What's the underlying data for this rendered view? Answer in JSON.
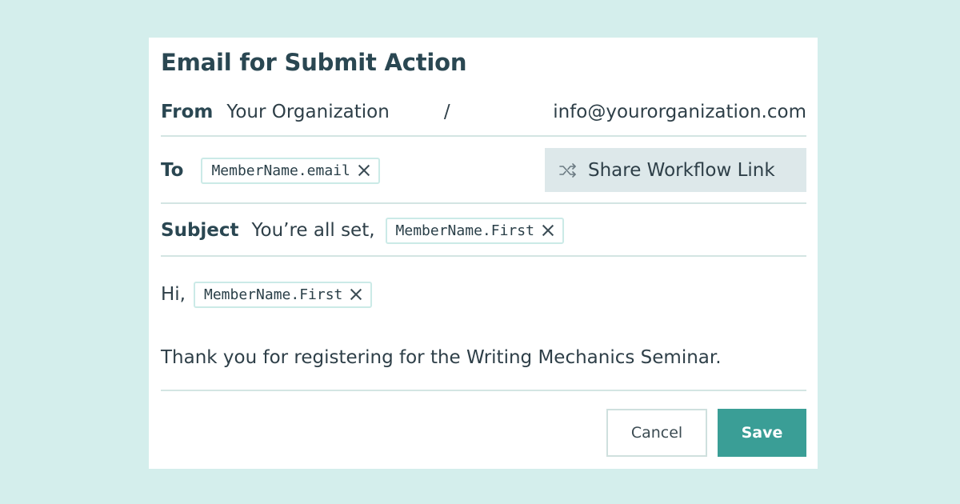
{
  "dialog": {
    "title": "Email for Submit Action",
    "from": {
      "label": "From",
      "name": "Your Organization",
      "separator": "/",
      "email": "info@yourorganization.com"
    },
    "to": {
      "label": "To",
      "chip": "MemberName.email",
      "share_button": "Share Workflow Link",
      "share_icon": "shuffle-icon"
    },
    "subject": {
      "label": "Subject",
      "text": "You’re all set,",
      "chip": "MemberName.First"
    },
    "body": {
      "greeting": "Hi,",
      "chip": "MemberName.First",
      "message": "Thank you for registering for the Writing Mechanics Seminar."
    },
    "footer": {
      "cancel": "Cancel",
      "save": "Save"
    }
  },
  "colors": {
    "background": "#d4eeec",
    "accent": "#3a9e96",
    "chip_border": "#cbeae7",
    "share_button_bg": "#dde8ea",
    "heading": "#2a4752"
  }
}
